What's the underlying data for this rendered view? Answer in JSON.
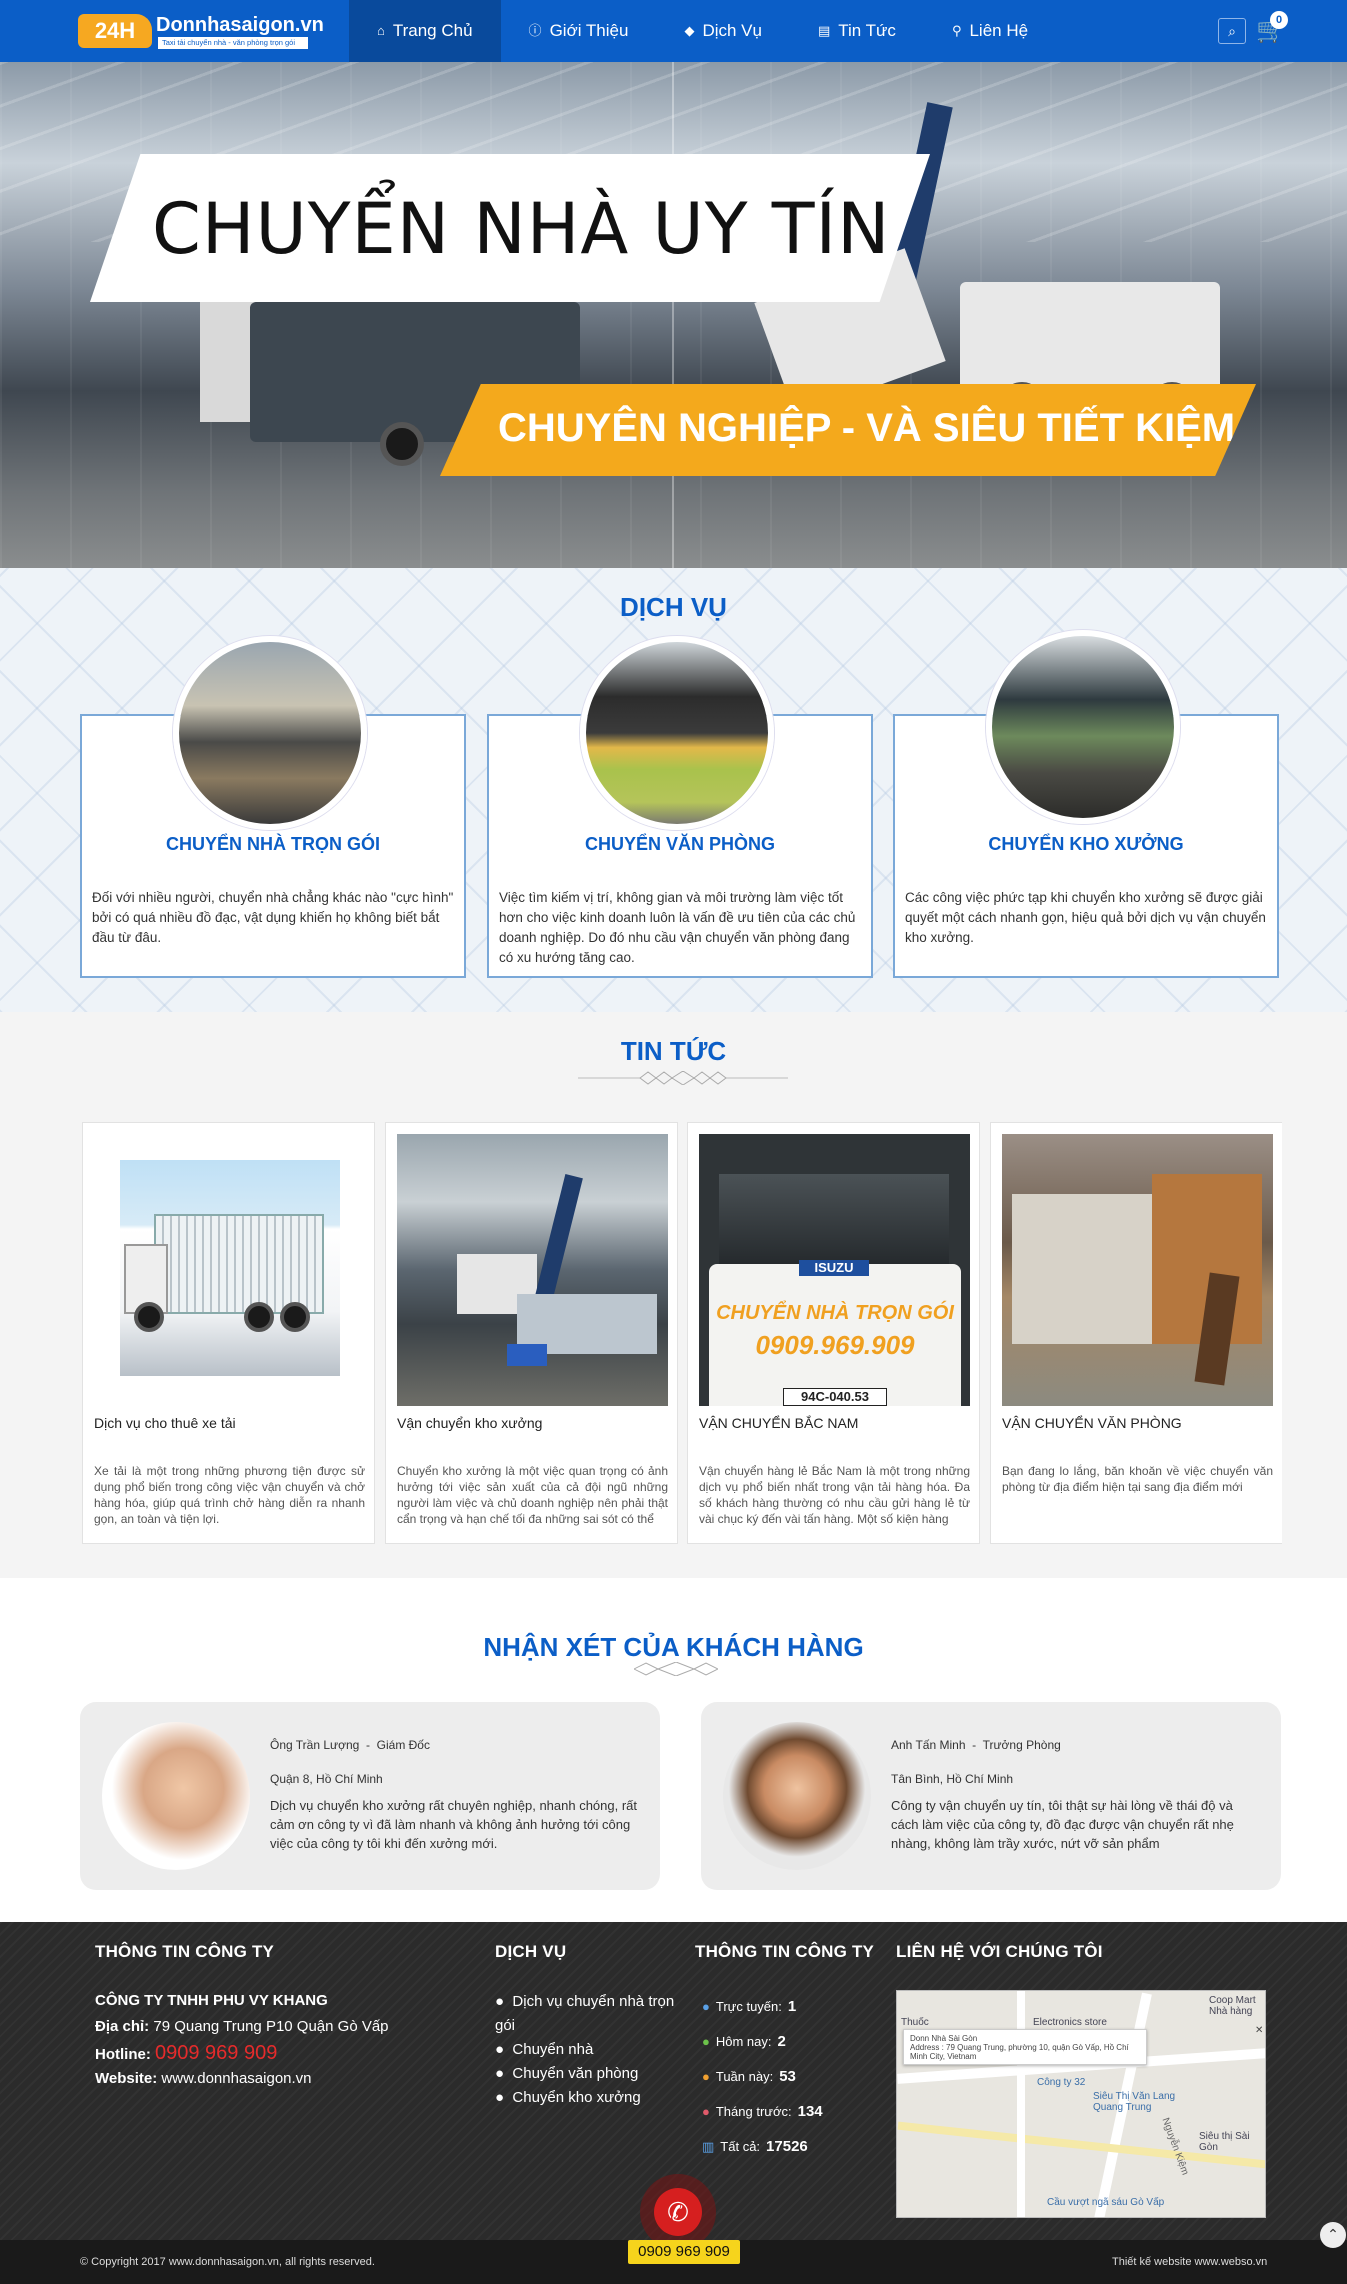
{
  "header": {
    "logo_badge": "24H",
    "logo_name": "Donnhasaigon.vn",
    "logo_tagline": "Taxi tải chuyển nhà - văn phòng trọn gói",
    "nav": [
      {
        "label": "Trang Chủ",
        "icon": "home-icon"
      },
      {
        "label": "Giới Thiệu",
        "icon": "info-icon"
      },
      {
        "label": "Dịch Vụ",
        "icon": "tag-icon"
      },
      {
        "label": "Tin Tức",
        "icon": "news-icon"
      },
      {
        "label": "Liên Hệ",
        "icon": "map-pin-icon"
      }
    ],
    "cart_count": "0"
  },
  "hero": {
    "title": "CHUYỂN NHÀ UY TÍN",
    "subtitle": "CHUYÊN NGHIỆP - VÀ SIÊU TIẾT KIỆM"
  },
  "services": {
    "title": "DỊCH VỤ",
    "items": [
      {
        "name": "CHUYỂN NHÀ TRỌN GÓI",
        "desc": "Đối với nhiều người, chuyển nhà chẳng khác nào \"cực hình\" bởi có quá nhiều đồ đạc, vật dụng khiến họ không biết bắt đầu từ đâu."
      },
      {
        "name": "CHUYỂN VĂN PHÒNG",
        "desc": "Việc tìm kiếm vị trí, không gian và môi trường làm việc tốt hơn cho việc kinh doanh luôn là vấn đề ưu tiên của các chủ doanh nghiệp. Do đó nhu cầu vận chuyển văn phòng đang có xu hướng tăng cao."
      },
      {
        "name": "CHUYỂN KHO XƯỞNG",
        "desc": "Các công việc phức tạp khi chuyển kho xưởng sẽ được giải quyết một cách nhanh gọn, hiệu quả bởi dịch vụ vận chuyển kho xưởng."
      }
    ]
  },
  "news": {
    "title": "TIN TỨC",
    "items": [
      {
        "title": "Dịch vụ cho thuê xe tải",
        "desc": "Xe tải là một trong những phương tiện được sử dụng phổ biến trong công việc vận chuyển và chở hàng hóa, giúp quá trình chở hàng diễn ra nhanh gọn, an toàn và tiện lợi."
      },
      {
        "title": "Vận chuyển kho xưởng",
        "desc": "Chuyển kho xưởng là một việc quan trọng có ảnh hưởng tới việc sản xuất của cả đội ngũ những người làm việc và chủ doanh nghiệp nên phải thật cẩn trọng và hạn chế tối đa những sai sót có thể"
      },
      {
        "title": "VẬN CHUYỂN BẮC NAM",
        "desc": "Vận chuyển hàng lẻ Bắc Nam là một trong những dịch vụ phổ biến nhất trong vận tải hàng hóa. Đa số khách hàng thường có nhu cầu gửi hàng lẻ từ vài chục ký đến vài tấn hàng. Một số kiện hàng"
      },
      {
        "title": "VẬN CHUYỂN VĂN PHÒNG",
        "desc": "Bạn đang lo lắng, băn khoăn về việc chuyển văn phòng từ địa điểm hiện tại sang địa điểm mới"
      }
    ],
    "truck_text_1": "CHUYỂN NHÀ TRỌN GÓI",
    "truck_text_2": "0909.969.909",
    "truck_plate": "94C-040.53",
    "truck_brand": "ISUZU"
  },
  "reviews": {
    "title": "NHẬN XÉT CỦA KHÁCH HÀNG",
    "items": [
      {
        "name": "Ông Trần Lượng",
        "role": "Giám Đốc",
        "location": "Quận 8, Hồ Chí Minh",
        "text": "Dịch vụ chuyển kho xưởng rất chuyên nghiệp, nhanh chóng, rất cảm ơn công ty vì đã làm nhanh và không ảnh hưởng tới công việc của công ty tôi khi đến xưởng mới."
      },
      {
        "name": "Anh Tấn Minh",
        "role": "Trưởng Phòng",
        "location": "Tân Bình, Hồ Chí Minh",
        "text": "Công ty vận chuyển uy tín, tôi thật sự hài lòng về thái độ và cách làm việc của công ty, đồ đạc được vận chuyển rất nhẹ nhàng, không làm trầy xước, nứt vỡ sản phẩm"
      }
    ]
  },
  "footer": {
    "company_head": "THÔNG TIN CÔNG TY",
    "company_name": "CÔNG TY TNHH PHU VY KHANG",
    "address_label": "Địa chỉ:",
    "address": "79 Quang Trung P10 Quận Gò Vấp",
    "hotline_label": "Hotline:",
    "hotline": "0909 969 909",
    "website_label": "Website:",
    "website": "www.donnhasaigon.vn",
    "service_head": "DỊCH VỤ",
    "services": [
      "Dịch vụ chuyển nhà trọn gói",
      "Chuyển nhà",
      "Chuyển văn phòng",
      "Chuyển kho xưởng"
    ],
    "stats_head": "THÔNG TIN CÔNG TY",
    "stats": [
      {
        "label": "Trực tuyến:",
        "value": "1",
        "color": "#5aa0e6"
      },
      {
        "label": "Hôm nay:",
        "value": "2",
        "color": "#6cc24a"
      },
      {
        "label": "Tuần này:",
        "value": "53",
        "color": "#f0a030"
      },
      {
        "label": "Tháng trước:",
        "value": "134",
        "color": "#e05a6a"
      },
      {
        "label": "Tất cả:",
        "value": "17526",
        "color": "#5aa0e6"
      }
    ],
    "contact_head": "LIÊN HỆ VỚI CHÚNG TÔI",
    "map_popup_title": "Donn Nhà Sài Gòn",
    "map_popup_addr": "Address : 79 Quang Trung, phường 10, quận Gò Vấp, Hồ Chí Minh City, Vietnam",
    "map_labels": [
      "Electronics store",
      "Coop Mart Nhà hàng",
      "Công ty 32",
      "Siêu Thị Văn Lang Quang Trung",
      "Cầu vượt ngã sáu Gò Vấp",
      "Nguyễn Kiệm",
      "Siêu thị Sài Gòn",
      "Thuốc"
    ],
    "copyright": "© Copyright 2017 www.donnhasaigon.vn, all rights reserved.",
    "credit": "Thiết kế website www.webso.vn",
    "call_number": "0909 969 909"
  }
}
